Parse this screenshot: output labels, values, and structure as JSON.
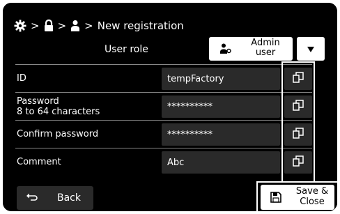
{
  "breadcrumb": {
    "separator": ">",
    "icons": [
      "gear-icon",
      "lock-icon",
      "user-icon"
    ],
    "page_title": "New registration"
  },
  "user_role": {
    "label": "User role",
    "value_line1": "Admin",
    "value_line2": "user",
    "icon": "user-key-icon"
  },
  "fields": [
    {
      "label_line1": "ID",
      "label_line2": "",
      "value": "tempFactory"
    },
    {
      "label_line1": "Password",
      "label_line2": "8 to 64 characters",
      "value": "**********"
    },
    {
      "label_line1": "Confirm password",
      "label_line2": "",
      "value": "**********"
    },
    {
      "label_line1": "Comment",
      "label_line2": "",
      "value": "Abc"
    }
  ],
  "footer": {
    "back_label": "Back",
    "save_label_line1": "Save &",
    "save_label_line2": "Close"
  },
  "colors": {
    "background": "#000000",
    "field": "#2a2a2a",
    "button_light": "#ffffff",
    "divider": "#888888"
  }
}
